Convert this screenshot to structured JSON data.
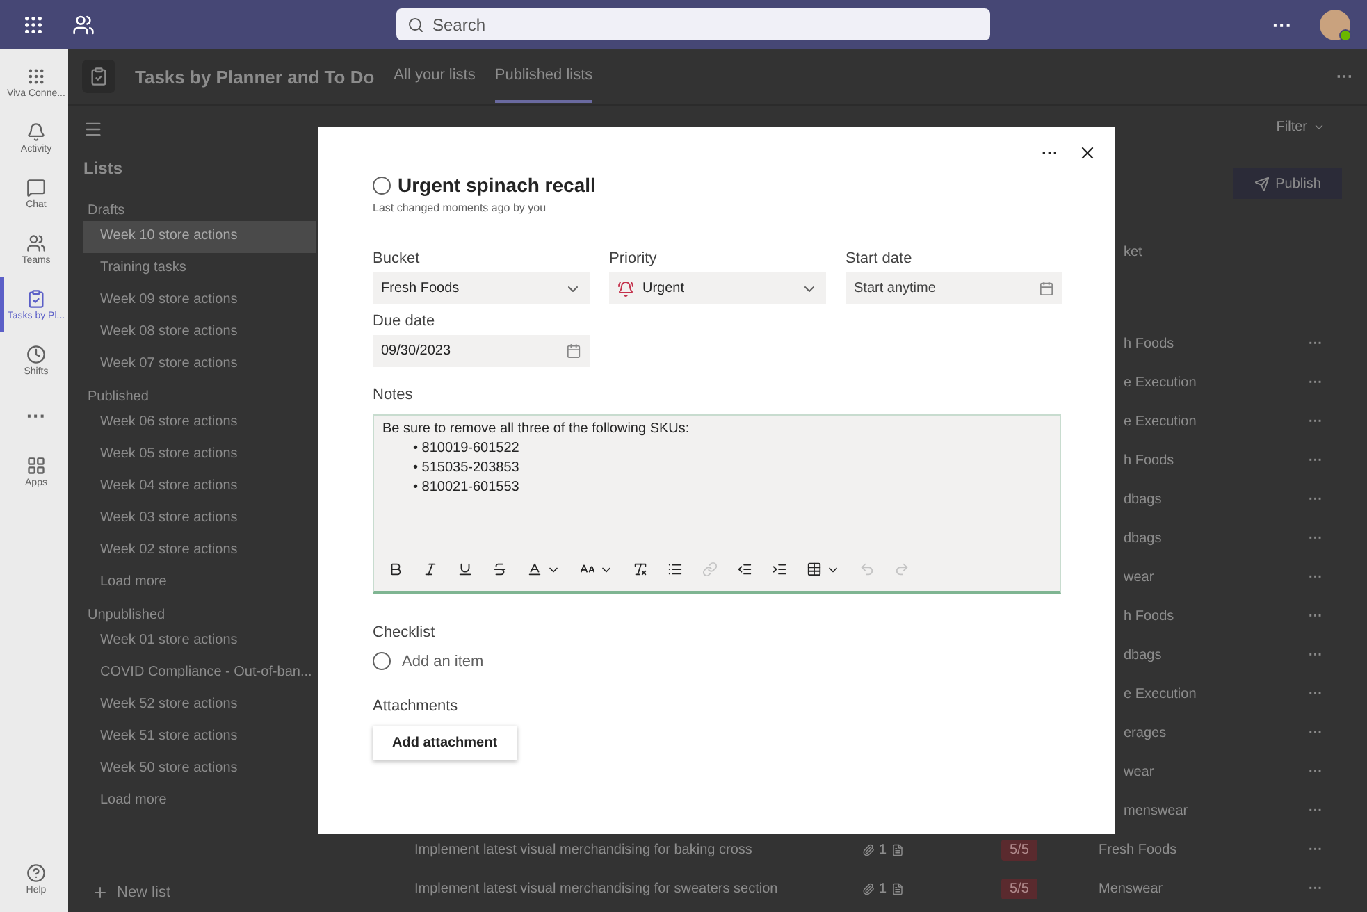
{
  "top_bar": {
    "search": {
      "placeholder": "Search"
    },
    "more": "···"
  },
  "rail": [
    {
      "kind": "viva",
      "label": "Viva Conne...",
      "selected": false
    },
    {
      "kind": "activity",
      "label": "Activity",
      "selected": false
    },
    {
      "kind": "chat",
      "label": "Chat",
      "selected": false
    },
    {
      "kind": "teams",
      "label": "Teams",
      "selected": false
    },
    {
      "kind": "tasks",
      "label": "Tasks by Pl...",
      "selected": true
    },
    {
      "kind": "shifts",
      "label": "Shifts",
      "selected": false
    },
    {
      "kind": "more",
      "label": "···",
      "selected": false
    },
    {
      "kind": "apps",
      "label": "Apps",
      "selected": false
    }
  ],
  "rail_help": {
    "label": "Help"
  },
  "app_header": {
    "title": "Tasks by Planner and To Do",
    "tabs": [
      {
        "label": "All your lists",
        "selected": false
      },
      {
        "label": "Published lists",
        "selected": true
      }
    ],
    "more": "···"
  },
  "lists_panel": {
    "heading": "Lists",
    "groups": [
      {
        "name": "Drafts",
        "items": [
          {
            "label": "Week 10 store actions",
            "selected": true
          },
          {
            "label": "Training tasks",
            "selected": false
          },
          {
            "label": "Week 09 store actions",
            "selected": false
          },
          {
            "label": "Week 08 store actions",
            "selected": false
          },
          {
            "label": "Week 07 store actions",
            "selected": false
          }
        ]
      },
      {
        "name": "Published",
        "items": [
          {
            "label": "Week 06 store actions",
            "selected": false
          },
          {
            "label": "Week 05 store actions",
            "selected": false
          },
          {
            "label": "Week 04 store actions",
            "selected": false
          },
          {
            "label": "Week 03 store actions",
            "selected": false
          },
          {
            "label": "Week 02 store actions",
            "selected": false
          }
        ],
        "load_more": "Load more"
      },
      {
        "name": "Unpublished",
        "items": [
          {
            "label": "Week 01 store actions",
            "selected": false
          },
          {
            "label": "COVID Compliance - Out-of-ban...",
            "selected": false
          },
          {
            "label": "Week 52 store actions",
            "selected": false
          },
          {
            "label": "Week 51 store actions",
            "selected": false
          },
          {
            "label": "Week 50 store actions",
            "selected": false
          }
        ],
        "load_more": "Load more"
      }
    ],
    "new_list": "New list"
  },
  "content": {
    "filter": "Filter",
    "publish": "Publish",
    "column_header": "ket",
    "rows": [
      {
        "bucket": "h Foods",
        "more": "···"
      },
      {
        "bucket": "e Execution",
        "more": "···"
      },
      {
        "bucket": "e Execution",
        "more": "···"
      },
      {
        "bucket": "h Foods",
        "more": "···"
      },
      {
        "bucket": "dbags",
        "more": "···"
      },
      {
        "bucket": "dbags",
        "more": "···"
      },
      {
        "bucket": "wear",
        "more": "···"
      },
      {
        "bucket": "h Foods",
        "more": "···"
      },
      {
        "bucket": "dbags",
        "more": "···"
      },
      {
        "bucket": "e Execution",
        "more": "···"
      },
      {
        "bucket": "erages",
        "more": "···"
      },
      {
        "bucket": "wear",
        "more": "···"
      },
      {
        "bucket": "menswear",
        "more": "···"
      },
      {
        "title": "Implement latest visual merchandising for baking cross",
        "attachments": "1",
        "badge": "5/5",
        "bucket": "Fresh Foods",
        "more": "···"
      },
      {
        "title": "Implement latest visual merchandising for sweaters section",
        "attachments": "1",
        "badge": "5/5",
        "bucket": "Menswear",
        "more": "···"
      }
    ]
  },
  "task_dialog": {
    "more": "···",
    "title": "Urgent spinach recall",
    "completed": false,
    "subtitle": "Last changed moments ago by you",
    "fields": [
      {
        "kind": "select",
        "label": "Bucket",
        "value": "Fresh Foods"
      },
      {
        "kind": "priority",
        "label": "Priority",
        "value": "Urgent"
      },
      {
        "kind": "date",
        "label": "Start date",
        "placeholder": "Start anytime"
      },
      {
        "kind": "date",
        "label": "Due date",
        "value": "09/30/2023"
      }
    ],
    "notes": {
      "label": "Notes",
      "text": "Be sure to remove all three of the following SKUs:",
      "bullet_marker": "•",
      "bullets": [
        "810019-601522",
        "515035-203853",
        "810021-601553"
      ],
      "toolbar": [
        {
          "kind": "bold",
          "disabled": false
        },
        {
          "kind": "italic",
          "disabled": false
        },
        {
          "kind": "underline",
          "disabled": false
        },
        {
          "kind": "strike",
          "disabled": false
        },
        {
          "kind": "font-color",
          "disabled": false
        },
        {
          "kind": "font-size",
          "disabled": false
        },
        {
          "kind": "clear",
          "disabled": false
        },
        {
          "kind": "list",
          "disabled": false
        },
        {
          "kind": "link",
          "disabled": true
        },
        {
          "kind": "outdent",
          "disabled": false
        },
        {
          "kind": "indent",
          "disabled": false
        },
        {
          "kind": "table",
          "disabled": false
        },
        {
          "kind": "undo",
          "disabled": true
        },
        {
          "kind": "redo",
          "disabled": true
        }
      ]
    },
    "checklist": {
      "label": "Checklist",
      "placeholder": "Add an item"
    },
    "attachments": {
      "label": "Attachments",
      "button": "Add attachment"
    }
  }
}
